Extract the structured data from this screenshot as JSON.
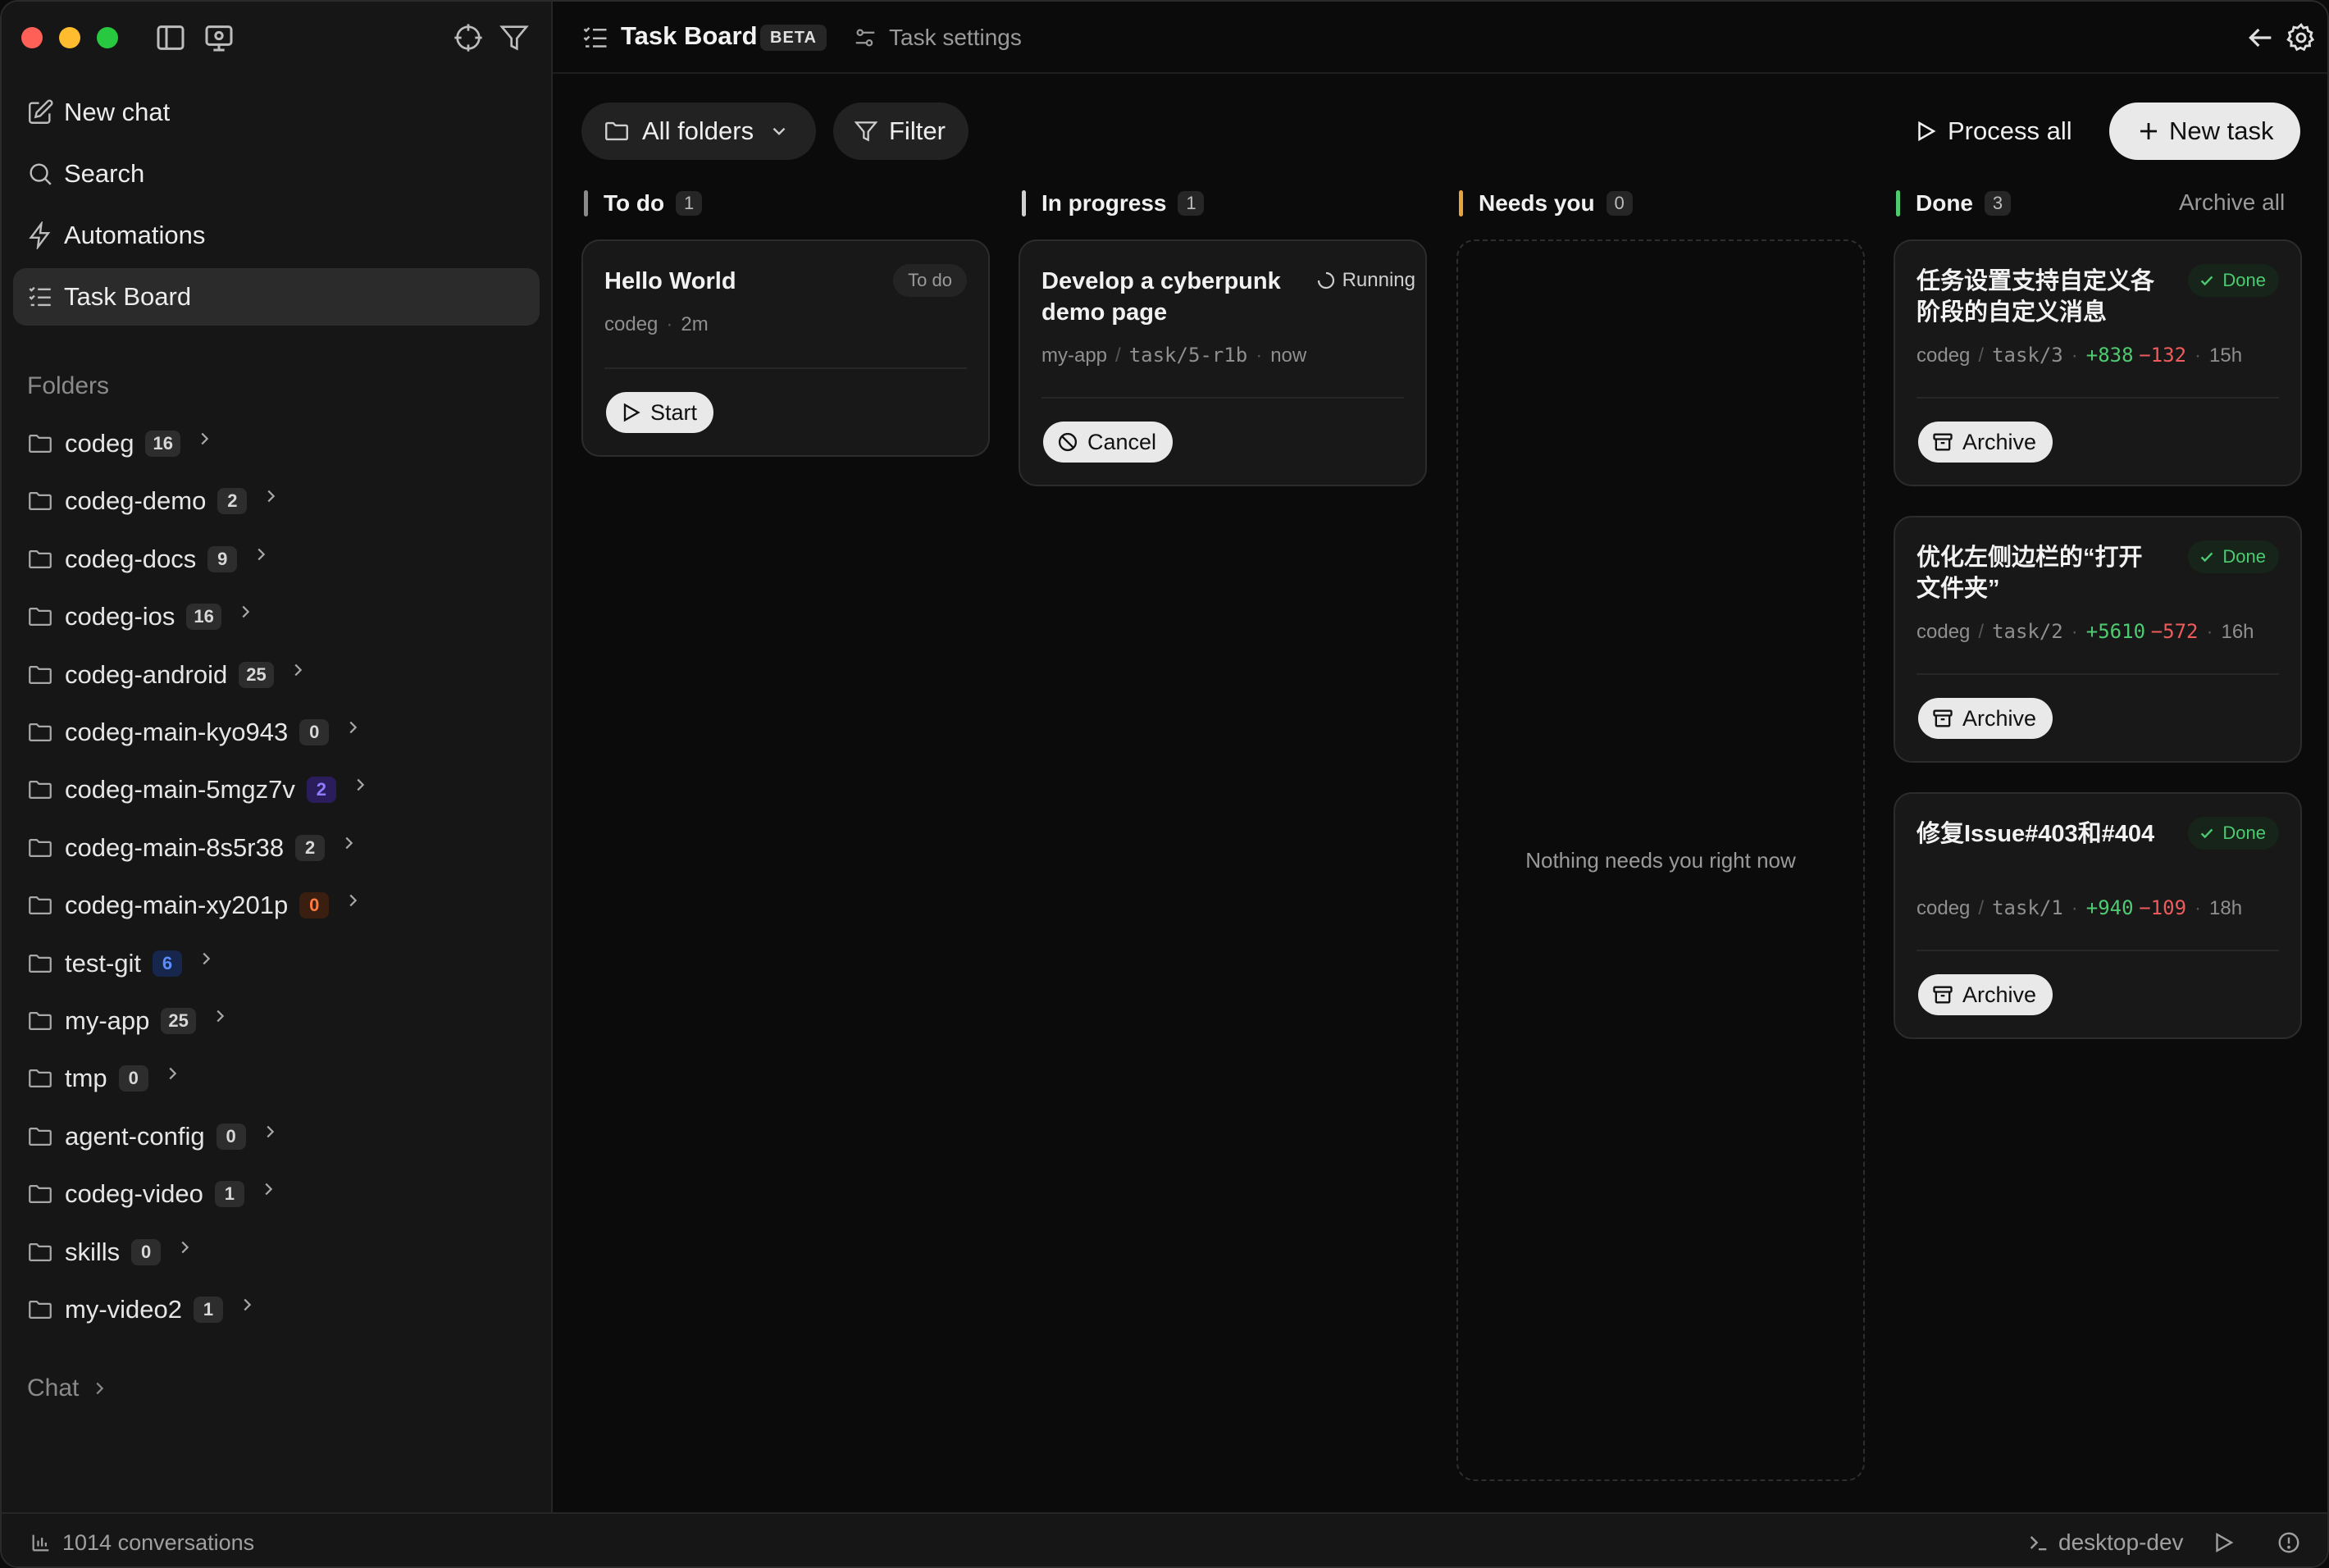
{
  "sidebar": {
    "nav": [
      {
        "label": "New chat",
        "icon": "pencil-square-icon"
      },
      {
        "label": "Search",
        "icon": "search-icon"
      },
      {
        "label": "Automations",
        "icon": "lightning-icon"
      },
      {
        "label": "Task Board",
        "icon": "task-list-icon",
        "active": true
      }
    ],
    "folders_label": "Folders",
    "folders": [
      {
        "name": "codeg",
        "count": "16"
      },
      {
        "name": "codeg-demo",
        "count": "2"
      },
      {
        "name": "codeg-docs",
        "count": "9"
      },
      {
        "name": "codeg-ios",
        "count": "16"
      },
      {
        "name": "codeg-android",
        "count": "25"
      },
      {
        "name": "codeg-main-kyo943",
        "count": "0"
      },
      {
        "name": "codeg-main-5mgz7v",
        "count": "2",
        "badge_color": "purple"
      },
      {
        "name": "codeg-main-8s5r38",
        "count": "2"
      },
      {
        "name": "codeg-main-xy201p",
        "count": "0",
        "badge_color": "orange"
      },
      {
        "name": "test-git",
        "count": "6",
        "badge_color": "blue"
      },
      {
        "name": "my-app",
        "count": "25"
      },
      {
        "name": "tmp",
        "count": "0"
      },
      {
        "name": "agent-config",
        "count": "0"
      },
      {
        "name": "codeg-video",
        "count": "1"
      },
      {
        "name": "skills",
        "count": "0"
      },
      {
        "name": "my-video2",
        "count": "1"
      }
    ],
    "chat_label": "Chat"
  },
  "topbar": {
    "title": "Task Board",
    "beta": "BETA",
    "settings_label": "Task settings"
  },
  "toolbar": {
    "all_folders": "All folders",
    "filter": "Filter",
    "process_all": "Process all",
    "new_task": "New task"
  },
  "columns": {
    "todo": {
      "title": "To do",
      "count": "1",
      "color": "#8a8a8a"
    },
    "progress": {
      "title": "In progress",
      "count": "1",
      "color": "#d0d0d0"
    },
    "needs": {
      "title": "Needs you",
      "count": "0",
      "color": "#e8a33a",
      "empty": "Nothing needs you right now"
    },
    "done": {
      "title": "Done",
      "count": "3",
      "color": "#4ecb71",
      "archive_all": "Archive all"
    }
  },
  "cards": {
    "todo": [
      {
        "title": "Hello World",
        "tag": "To do",
        "folder": "codeg",
        "time": "2m",
        "action": "Start"
      }
    ],
    "progress": [
      {
        "title": "Develop a cyberpunk demo page",
        "tag": "Running",
        "folder": "my-app",
        "branch": "task/5-r1b",
        "time": "now",
        "action": "Cancel"
      }
    ],
    "done": [
      {
        "title": "任务设置支持自定义各阶段的自定义消息",
        "tag": "Done",
        "folder": "codeg",
        "branch": "task/3",
        "added": "+838",
        "removed": "−132",
        "time": "15h",
        "action": "Archive"
      },
      {
        "title": "优化左侧边栏的“打开文件夹”",
        "tag": "Done",
        "folder": "codeg",
        "branch": "task/2",
        "added": "+5610",
        "removed": "−572",
        "time": "16h",
        "action": "Archive"
      },
      {
        "title": "修复Issue#403和#404",
        "tag": "Done",
        "folder": "codeg",
        "branch": "task/1",
        "added": "+940",
        "removed": "−109",
        "time": "18h",
        "action": "Archive"
      }
    ]
  },
  "statusbar": {
    "conversations": "1014 conversations",
    "env": "desktop-dev"
  }
}
